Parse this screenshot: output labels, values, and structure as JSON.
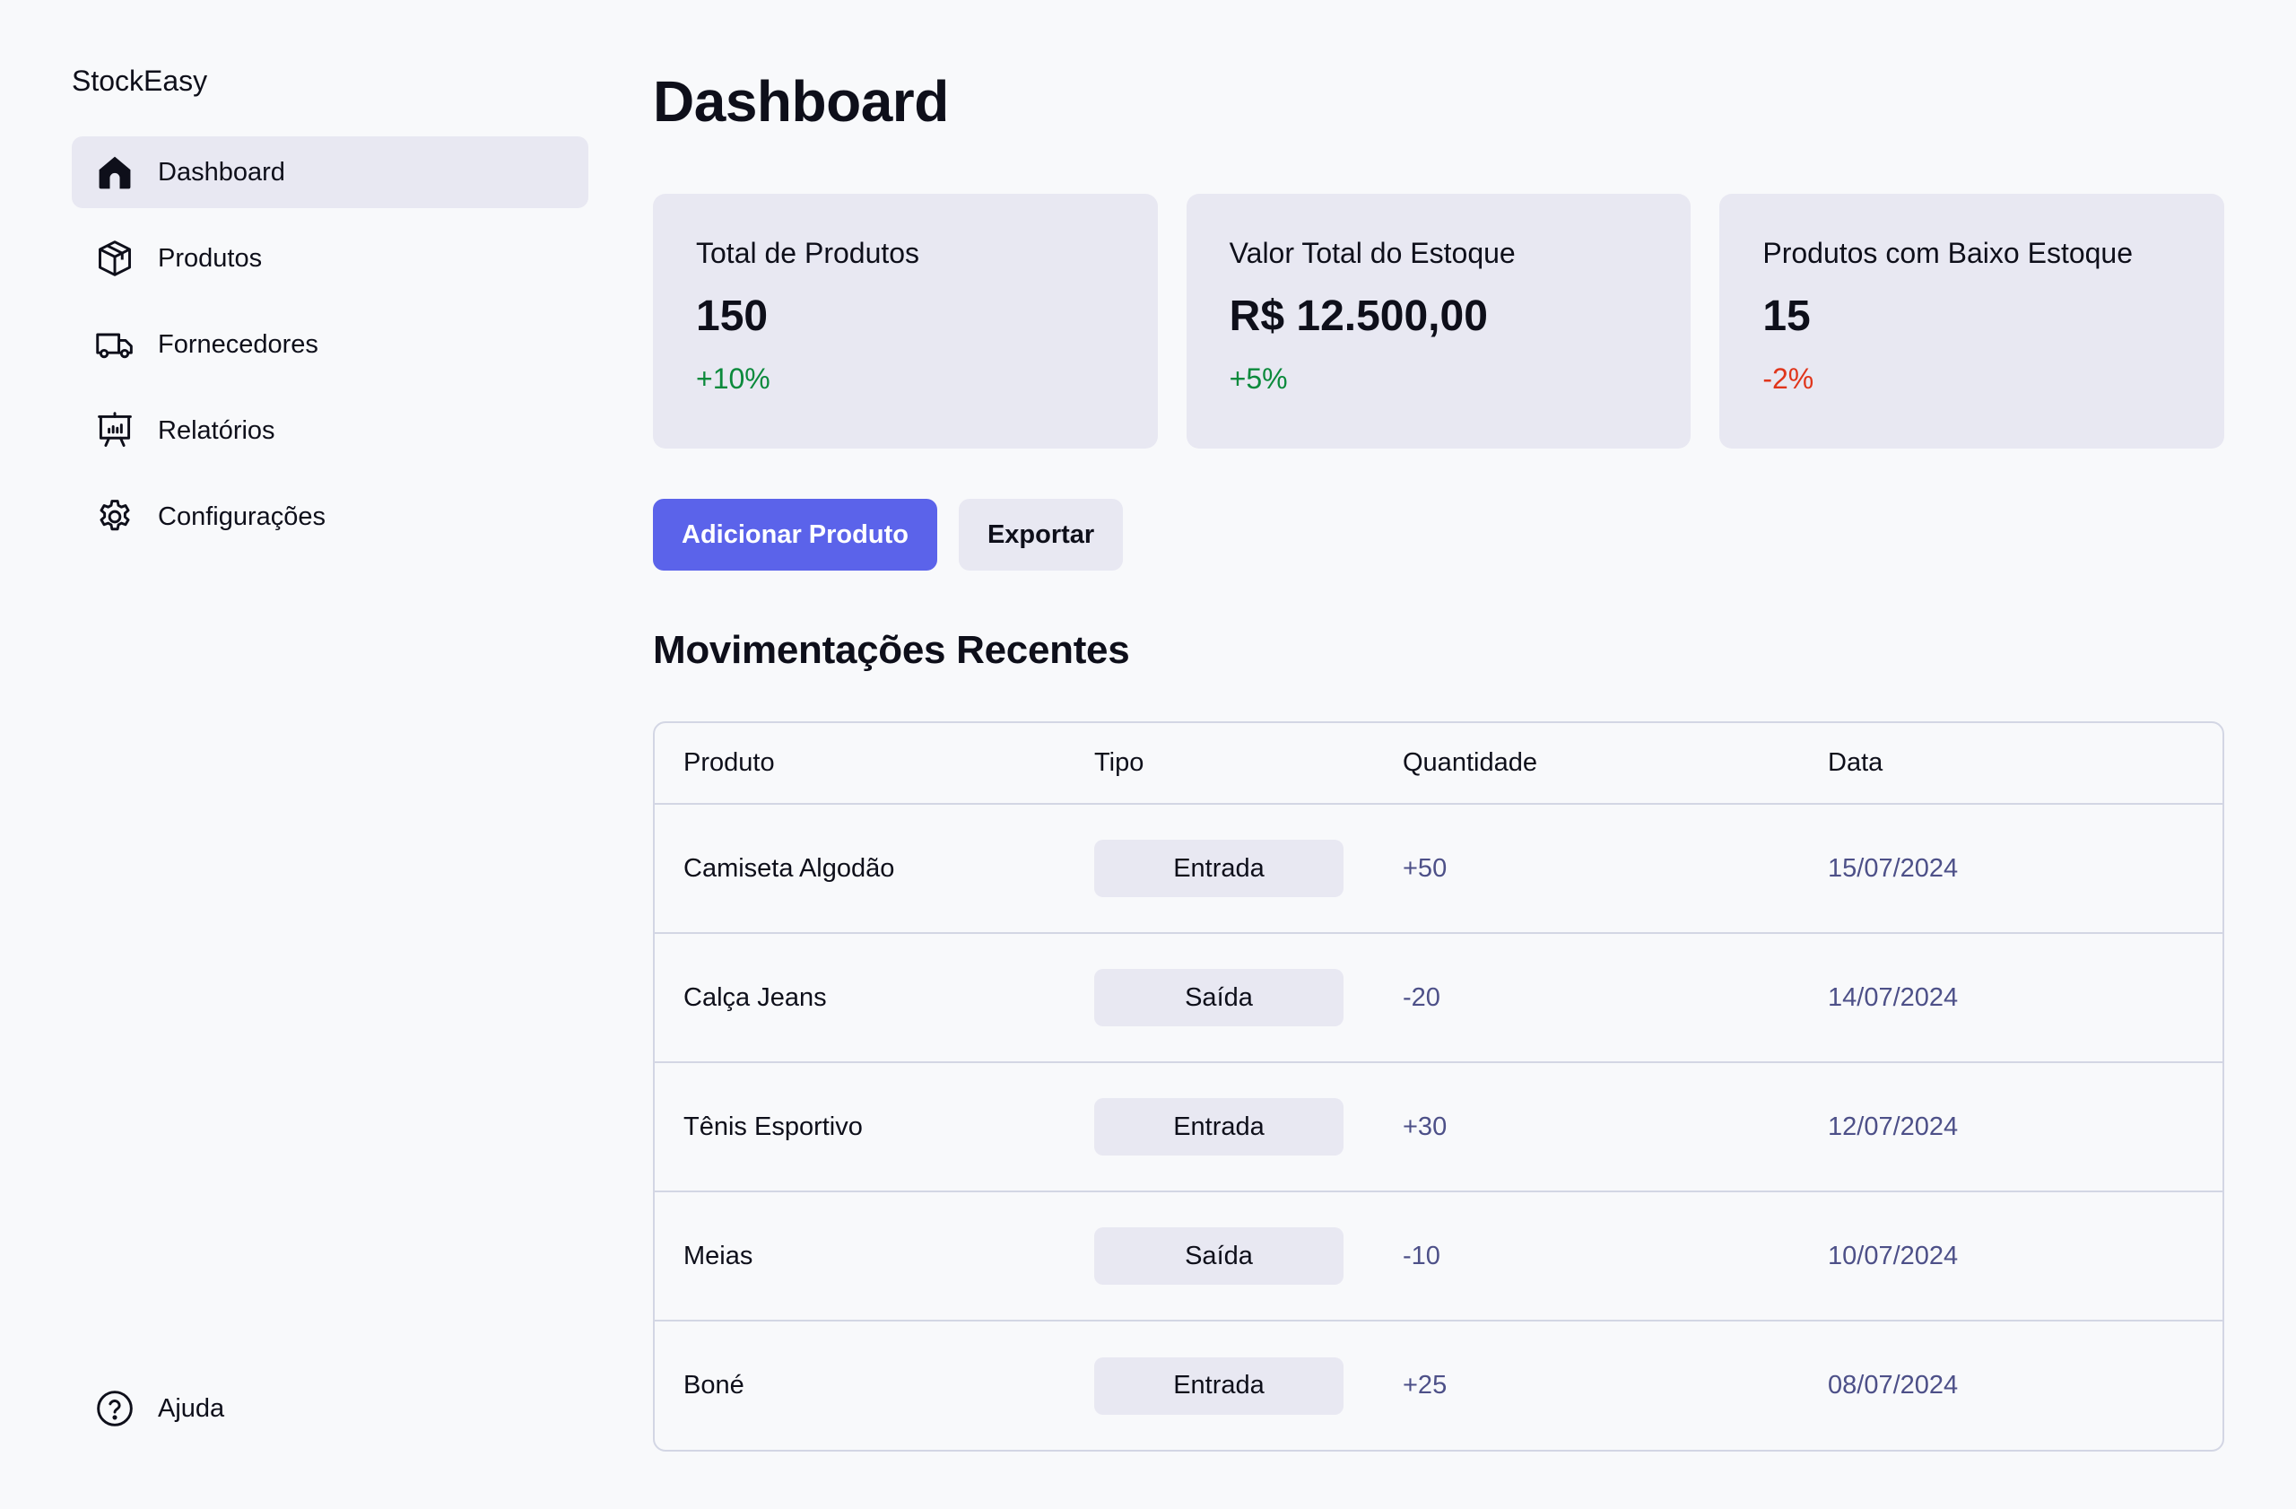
{
  "brand": "StockEasy",
  "sidebar": {
    "items": [
      {
        "label": "Dashboard",
        "icon": "home-icon",
        "active": true
      },
      {
        "label": "Produtos",
        "icon": "box-icon",
        "active": false
      },
      {
        "label": "Fornecedores",
        "icon": "truck-icon",
        "active": false
      },
      {
        "label": "Relatórios",
        "icon": "presentation-chart-icon",
        "active": false
      },
      {
        "label": "Configurações",
        "icon": "gear-icon",
        "active": false
      }
    ],
    "help": {
      "label": "Ajuda",
      "icon": "help-circle-icon"
    }
  },
  "page": {
    "title": "Dashboard"
  },
  "cards": [
    {
      "label": "Total de Produtos",
      "value": "150",
      "delta": "+10%",
      "trend": "up"
    },
    {
      "label": "Valor Total do Estoque",
      "value": "R$ 12.500,00",
      "delta": "+5%",
      "trend": "up"
    },
    {
      "label": "Produtos com Baixo Estoque",
      "value": "15",
      "delta": "-2%",
      "trend": "down"
    }
  ],
  "actions": {
    "add_label": "Adicionar Produto",
    "export_label": "Exportar"
  },
  "movements": {
    "title": "Movimentações Recentes",
    "columns": [
      "Produto",
      "Tipo",
      "Quantidade",
      "Data"
    ],
    "rows": [
      {
        "produto": "Camiseta Algodão",
        "tipo": "Entrada",
        "quantidade": "+50",
        "data": "15/07/2024"
      },
      {
        "produto": "Calça Jeans",
        "tipo": "Saída",
        "quantidade": "-20",
        "data": "14/07/2024"
      },
      {
        "produto": "Tênis Esportivo",
        "tipo": "Entrada",
        "quantidade": "+30",
        "data": "12/07/2024"
      },
      {
        "produto": "Meias",
        "tipo": "Saída",
        "quantidade": "-10",
        "data": "10/07/2024"
      },
      {
        "produto": "Boné",
        "tipo": "Entrada",
        "quantidade": "+25",
        "data": "08/07/2024"
      }
    ]
  },
  "colors": {
    "accent": "#5b63ea",
    "positive": "#0b8a3c",
    "negative": "#e0351b",
    "surface": "#e8e8f2",
    "background": "#f8f9fb"
  }
}
